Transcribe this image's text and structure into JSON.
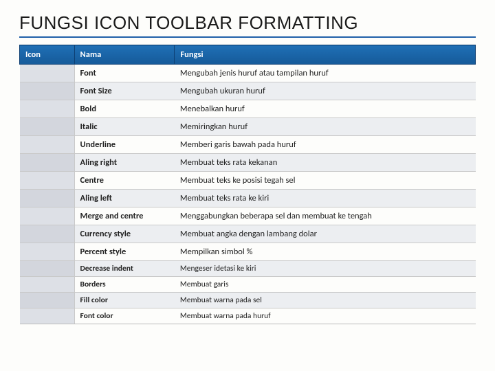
{
  "title": "FUNGSI ICON TOOLBAR FORMATTING",
  "headers": {
    "icon": "Icon",
    "nama": "Nama",
    "fungsi": "Fungsi"
  },
  "rows": [
    {
      "nama": "Font",
      "fungsi": "Mengubah jenis huruf atau tampilan huruf"
    },
    {
      "nama": "Font Size",
      "fungsi": "Mengubah ukuran huruf"
    },
    {
      "nama": "Bold",
      "fungsi": "Menebalkan huruf"
    },
    {
      "nama": "Italic",
      "fungsi": "Memiringkan huruf"
    },
    {
      "nama": "Underline",
      "fungsi": "Memberi garis bawah pada huruf"
    },
    {
      "nama": "Aling right",
      "fungsi": "Membuat teks rata kekanan"
    },
    {
      "nama": "Centre",
      "fungsi": "Membuat teks ke posisi tegah sel"
    },
    {
      "nama": "Aling left",
      "fungsi": "Membuat teks rata ke kiri"
    },
    {
      "nama": "Merge and centre",
      "fungsi": "Menggabungkan beberapa sel  dan membuat ke tengah"
    },
    {
      "nama": "Currency style",
      "fungsi": "Membuat angka dengan lambang dolar"
    },
    {
      "nama": "Percent style",
      "fungsi": "Mempilkan simbol %"
    },
    {
      "nama": "Decrease indent",
      "fungsi": "Mengeser idetasi ke kiri",
      "small": true
    },
    {
      "nama": "Borders",
      "fungsi": "Membuat garis",
      "small": true
    },
    {
      "nama": "Fill color",
      "fungsi": "Membuat warna pada sel",
      "small": true
    },
    {
      "nama": "Font color",
      "fungsi": "Membuat warna pada huruf",
      "small": true
    }
  ]
}
